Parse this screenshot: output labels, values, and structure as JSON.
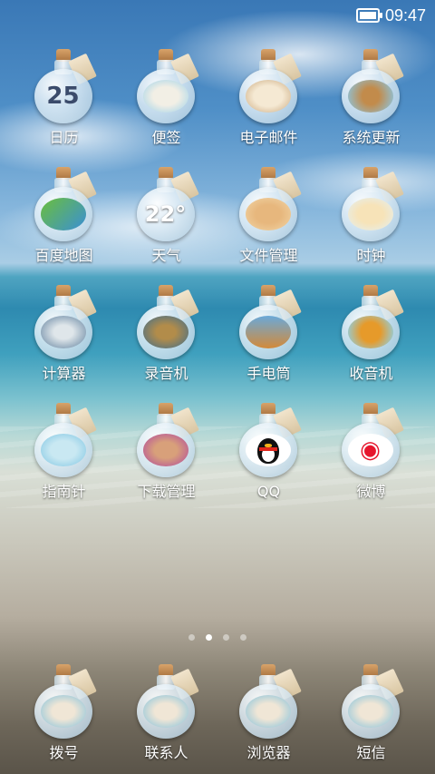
{
  "status_bar": {
    "time": "09:47"
  },
  "apps": [
    {
      "name": "app-calendar",
      "icon": "calendar-bottle-icon",
      "label": "日历",
      "badge": "25",
      "style": "c-cal"
    },
    {
      "name": "app-notes",
      "icon": "paper-boat-bottle-icon",
      "label": "便签",
      "badge": "",
      "style": "c-note"
    },
    {
      "name": "app-email",
      "icon": "seashell-bottle-icon",
      "label": "电子邮件",
      "badge": "",
      "style": "c-mail"
    },
    {
      "name": "app-system-update",
      "icon": "starfish-bottle-icon",
      "label": "系统更新",
      "badge": "",
      "style": "c-update"
    },
    {
      "name": "app-baidu-map",
      "icon": "map-bottle-icon",
      "label": "百度地图",
      "badge": "",
      "style": "c-map"
    },
    {
      "name": "app-weather",
      "icon": "weather-bottle-icon",
      "label": "天气",
      "badge": "22°",
      "style": "c-weather"
    },
    {
      "name": "app-file-manager",
      "icon": "shells-bottle-icon",
      "label": "文件管理",
      "badge": "",
      "style": "c-files"
    },
    {
      "name": "app-clock",
      "icon": "starfish-bottle-icon",
      "label": "时钟",
      "badge": "",
      "style": "c-clock"
    },
    {
      "name": "app-calculator",
      "icon": "cone-shell-bottle-icon",
      "label": "计算器",
      "badge": "",
      "style": "c-calc"
    },
    {
      "name": "app-recorder",
      "icon": "spotted-shell-bottle-icon",
      "label": "录音机",
      "badge": "",
      "style": "c-rec"
    },
    {
      "name": "app-flashlight",
      "icon": "conch-bottle-icon",
      "label": "手电筒",
      "badge": "",
      "style": "c-torch"
    },
    {
      "name": "app-radio",
      "icon": "starfish-bottle-icon",
      "label": "收音机",
      "badge": "",
      "style": "c-radio"
    },
    {
      "name": "app-compass",
      "icon": "jellyfish-bottle-icon",
      "label": "指南针",
      "badge": "",
      "style": "c-compass"
    },
    {
      "name": "app-download-manager",
      "icon": "nautilus-bottle-icon",
      "label": "下载管理",
      "badge": "",
      "style": "c-down"
    },
    {
      "name": "app-qq",
      "icon": "qq-penguin-icon",
      "label": "QQ",
      "badge": "",
      "style": "c-qq"
    },
    {
      "name": "app-weibo",
      "icon": "weibo-icon",
      "label": "微博",
      "badge": "",
      "style": "c-weibo"
    }
  ],
  "pager": {
    "pages": 4,
    "active": 1
  },
  "dock": [
    {
      "name": "dock-dialer",
      "icon": "shell-bottle-icon",
      "label": "拨号"
    },
    {
      "name": "dock-contacts",
      "icon": "shell-bottle-icon",
      "label": "联系人"
    },
    {
      "name": "dock-browser",
      "icon": "shell-bottle-icon",
      "label": "浏览器"
    },
    {
      "name": "dock-sms",
      "icon": "shell-bottle-icon",
      "label": "短信"
    }
  ]
}
